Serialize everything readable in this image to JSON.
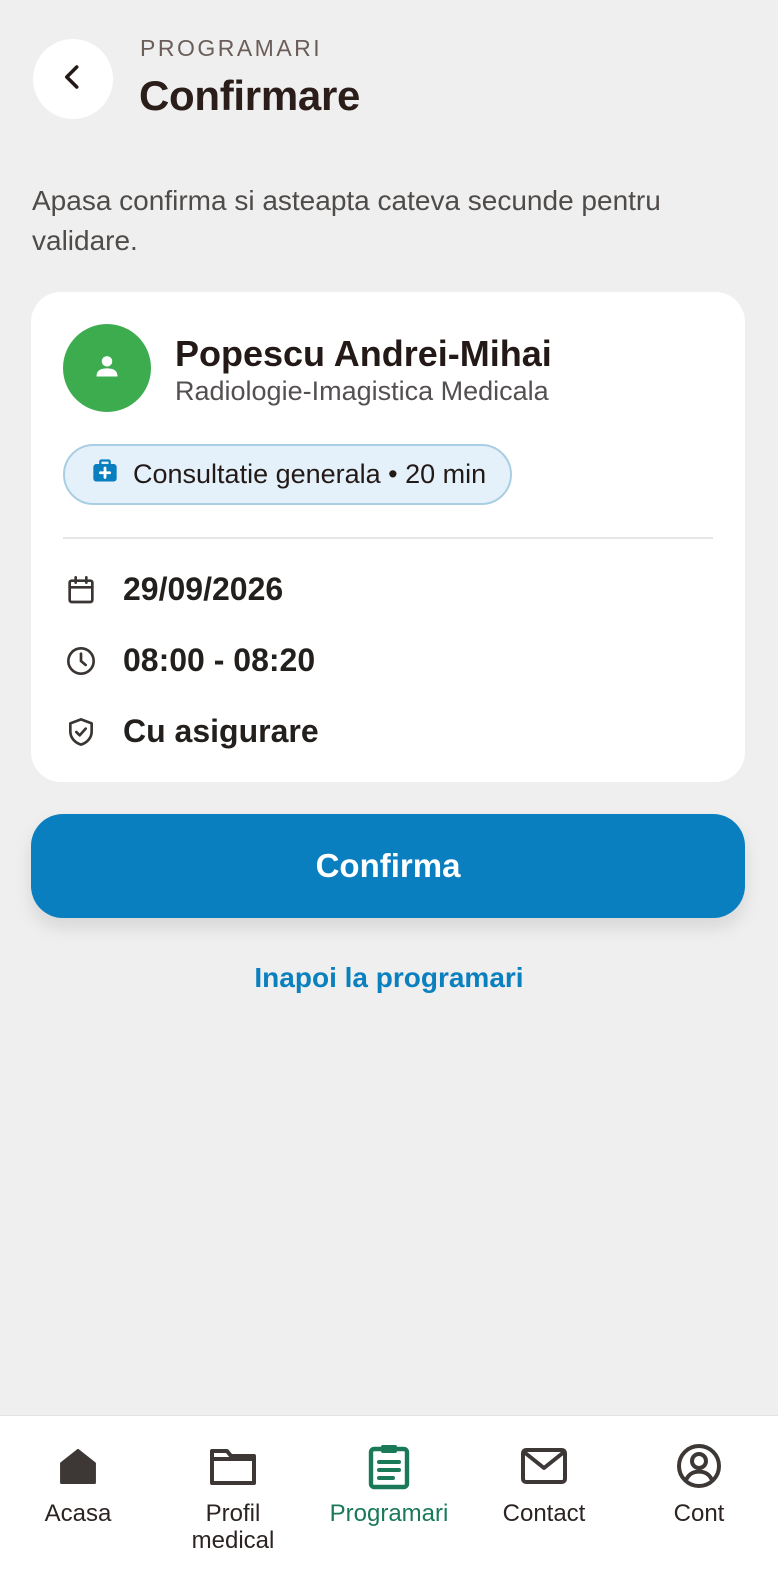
{
  "header": {
    "overline": "PROGRAMARI",
    "title": "Confirmare"
  },
  "intro": "Apasa confirma si asteapta cateva secunde pentru validare.",
  "card": {
    "doctor_name": "Popescu Andrei-Mihai",
    "specialty": "Radiologie-Imagistica Medicala",
    "service_chip": "Consultatie generala • 20 min",
    "date": "29/09/2026",
    "time": "08:00 - 08:20",
    "insurance": "Cu asigurare"
  },
  "actions": {
    "confirm_label": "Confirma",
    "back_label": "Inapoi la programari"
  },
  "nav": {
    "items": [
      {
        "label": "Acasa",
        "icon": "home-icon"
      },
      {
        "label": "Profil medical",
        "icon": "folder-icon"
      },
      {
        "label": "Programari",
        "icon": "clipboard-icon",
        "active": true
      },
      {
        "label": "Contact",
        "icon": "mail-icon"
      },
      {
        "label": "Cont",
        "icon": "account-icon"
      }
    ]
  },
  "colors": {
    "primary": "#0a7fbf",
    "avatar": "#3cac4f",
    "nav_active": "#1a7a58",
    "background": "#efefef"
  }
}
